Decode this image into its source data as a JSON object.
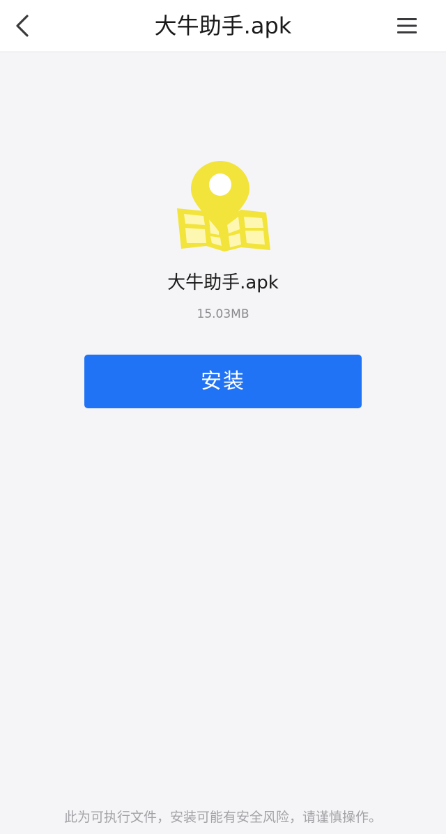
{
  "header": {
    "title": "大牛助手.apk",
    "back_icon": "chevron-left-icon",
    "menu_icon": "menu-icon"
  },
  "file": {
    "name": "大牛助手.apk",
    "size": "15.03MB",
    "icon": "map-pin-icon",
    "icon_color": "#f2e43a"
  },
  "actions": {
    "install_label": "安装",
    "install_color": "#2173f5"
  },
  "footer": {
    "warning": "此为可执行文件，安装可能有安全风险，请谨慎操作。"
  }
}
